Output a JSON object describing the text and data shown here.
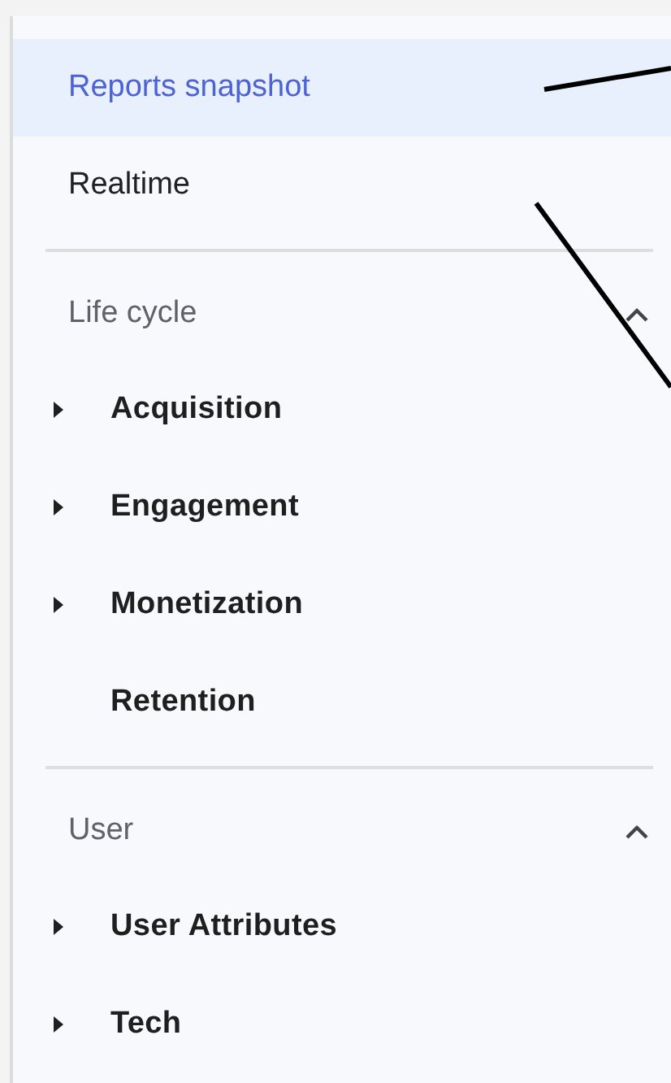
{
  "nav": {
    "top_items": [
      {
        "label": "Reports snapshot",
        "selected": true
      },
      {
        "label": "Realtime",
        "selected": false
      }
    ],
    "sections": [
      {
        "title": "Life cycle",
        "expanded": true,
        "items": [
          {
            "label": "Acquisition",
            "expandable": true
          },
          {
            "label": "Engagement",
            "expandable": true
          },
          {
            "label": "Monetization",
            "expandable": true
          },
          {
            "label": "Retention",
            "expandable": false
          }
        ]
      },
      {
        "title": "User",
        "expanded": true,
        "items": [
          {
            "label": "User Attributes",
            "expandable": true
          },
          {
            "label": "Tech",
            "expandable": true
          }
        ]
      }
    ]
  }
}
